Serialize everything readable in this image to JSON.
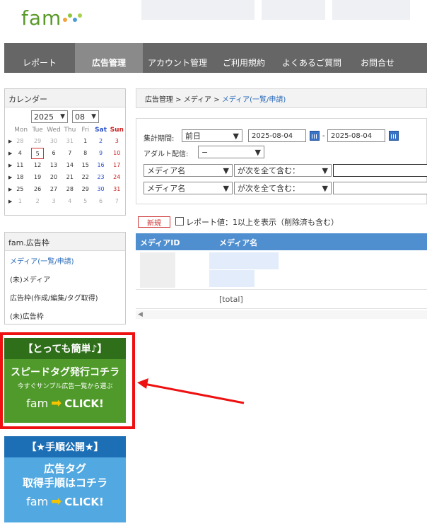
{
  "header": {
    "logo": "fam"
  },
  "nav": {
    "items": [
      {
        "label": "レポート"
      },
      {
        "label": "広告管理",
        "active": true
      },
      {
        "label": "アカウント管理"
      },
      {
        "label": "ご利用規約"
      },
      {
        "label": "よくあるご質問"
      },
      {
        "label": "お問合せ"
      }
    ]
  },
  "sidebar": {
    "calendar": {
      "title": "カレンダー",
      "year": "2025",
      "month": "08",
      "weekdays": [
        "Mon",
        "Tue",
        "Wed",
        "Thu",
        "Fri",
        "Sat",
        "Sun"
      ],
      "weeks": [
        [
          "28",
          "29",
          "30",
          "31",
          "1",
          "2",
          "3"
        ],
        [
          "4",
          "5",
          "6",
          "7",
          "8",
          "9",
          "10"
        ],
        [
          "11",
          "12",
          "13",
          "14",
          "15",
          "16",
          "17"
        ],
        [
          "18",
          "19",
          "20",
          "21",
          "22",
          "23",
          "24"
        ],
        [
          "25",
          "26",
          "27",
          "28",
          "29",
          "30",
          "31"
        ],
        [
          "1",
          "2",
          "3",
          "4",
          "5",
          "6",
          "7"
        ]
      ],
      "today": "5"
    },
    "ad_menu": {
      "title": "fam.広告枠",
      "items": [
        {
          "label": "メディア(一覧/申請)"
        },
        {
          "label": "(未)メディア"
        },
        {
          "label": "広告枠(作成/編集/タグ取得)"
        },
        {
          "label": "(未)広告枠"
        }
      ]
    },
    "banner_green": {
      "title": "【とっても簡単♪】",
      "main": "スピードタグ発行コチラ",
      "sub": "今すぐサンプル広告一覧から選ぶ",
      "logo": "fam",
      "cta": "CLICK!"
    },
    "banner_blue": {
      "title": "【★手順公開★】",
      "line1": "広告タグ",
      "line2": "取得手順はコチラ",
      "logo": "fam",
      "cta": "CLICK!"
    }
  },
  "main": {
    "breadcrumb": {
      "part1": "広告管理",
      "sep": " > ",
      "part2": "メディア",
      "part3": "メディア(一覧/申請)"
    },
    "filters": {
      "period_label": "集計期間:",
      "period_value": "前日",
      "date_from": "2025-08-04",
      "date_sep": "-",
      "date_to": "2025-08-04",
      "adult_label": "アダルト配信:",
      "adult_value": "−",
      "row1_field": "メディア名",
      "row1_cond": "が次を全て含む：",
      "row2_field": "メディア名",
      "row2_cond": "が次を全て含む："
    },
    "new_button": "新規",
    "report_checkbox_label": "レポート値：1以上を表示（削除済も含む）",
    "table": {
      "columns": [
        "メディアID",
        "メディア名"
      ],
      "total_label": "[total]",
      "scroll_left": "◀"
    }
  },
  "colors": {
    "nav_bg": "#666666",
    "nav_active": "#8a8a8a",
    "table_header": "#4f8fd0",
    "link": "#2a6ab8",
    "banner_green": "#4f9a2a",
    "banner_blue": "#52a8e0",
    "highlight_red": "#ee1111"
  }
}
